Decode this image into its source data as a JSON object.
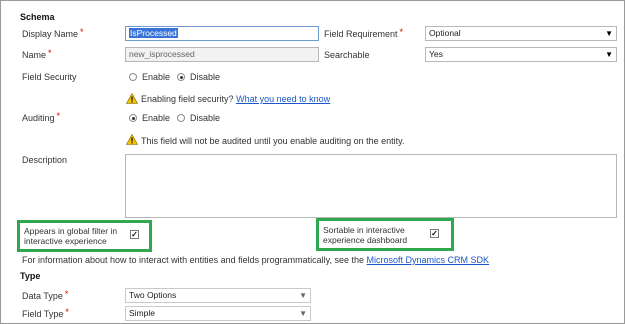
{
  "schema": {
    "heading": "Schema",
    "display_name": {
      "label": "Display Name",
      "required_mark": "*",
      "value": "IsProcessed"
    },
    "name": {
      "label": "Name",
      "required_mark": "*",
      "value": "new_isprocessed"
    },
    "field_requirement": {
      "label": "Field Requirement",
      "required_mark": "*",
      "value": "Optional"
    },
    "searchable": {
      "label": "Searchable",
      "value": "Yes"
    },
    "field_security": {
      "label": "Field Security",
      "options": [
        "Enable",
        "Disable"
      ],
      "selected": "Disable",
      "warning_text": "Enabling field security?",
      "warning_link": "What you need to know"
    },
    "auditing": {
      "label": "Auditing",
      "required_mark": "*",
      "options": [
        "Enable",
        "Disable"
      ],
      "selected": "Enable",
      "warning_text": "This field will not be audited until you enable auditing on the entity."
    },
    "description": {
      "label": "Description",
      "value": ""
    },
    "global_filter": {
      "label_line1": "Appears in global filter in",
      "label_line2": "interactive experience",
      "checked": true
    },
    "sortable": {
      "label_line1": "Sortable in interactive",
      "label_line2": "experience dashboard",
      "checked": true
    },
    "info_text": "For information about how to interact with entities and fields programmatically, see the",
    "info_link": "Microsoft Dynamics CRM SDK"
  },
  "type": {
    "heading": "Type",
    "data_type": {
      "label": "Data Type",
      "required_mark": "*",
      "value": "Two Options"
    },
    "field_type": {
      "label": "Field Type",
      "required_mark": "*",
      "value": "Simple"
    }
  },
  "colors": {
    "accent_link": "#1a56c9",
    "required": "#e00000",
    "highlight_box": "#2fa84f",
    "selection": "#3874d8"
  },
  "icons": {
    "warning": "warning-triangle-icon",
    "dropdown": "dropdown-arrow-icon",
    "check": "checkmark-icon"
  }
}
